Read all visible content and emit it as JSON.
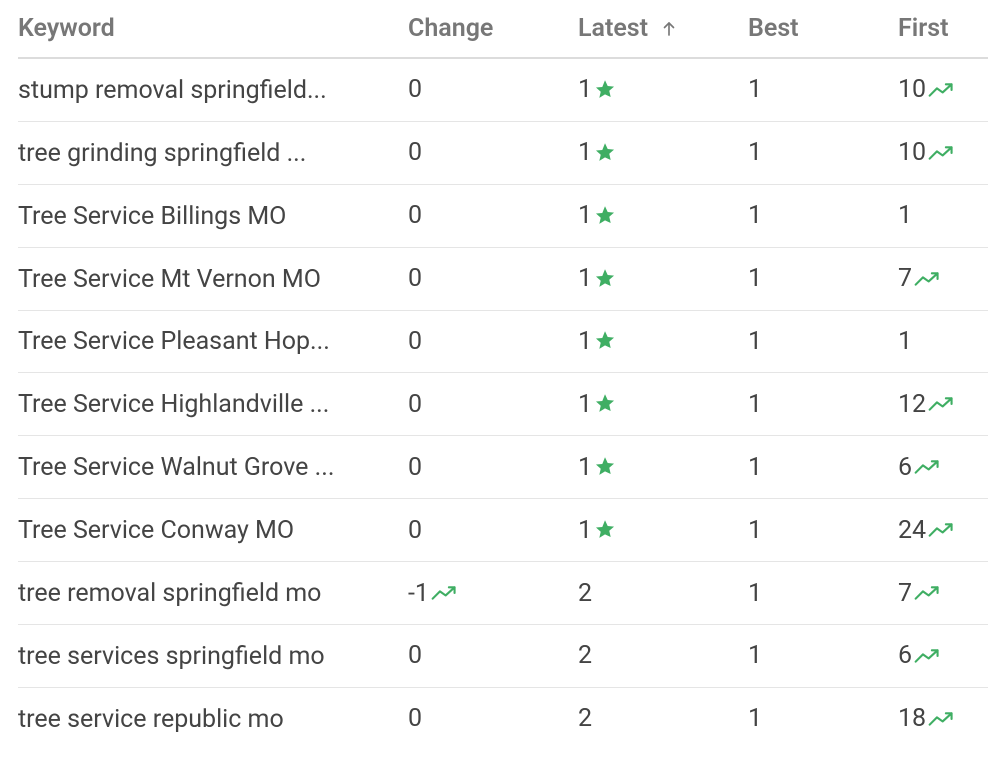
{
  "colors": {
    "green": "#3fae63",
    "headerText": "#777",
    "bodyText": "#444",
    "border": "#e5e5e5"
  },
  "table": {
    "headers": {
      "keyword": "Keyword",
      "change": "Change",
      "latest": "Latest",
      "best": "Best",
      "first": "First"
    },
    "sort": {
      "column": "latest",
      "dir": "asc"
    },
    "rows": [
      {
        "keyword": "stump removal springfield...",
        "change": "0",
        "change_trend": false,
        "latest": "1",
        "latest_star": true,
        "best": "1",
        "first": "10",
        "first_trend": true
      },
      {
        "keyword": "tree grinding springfield ...",
        "change": "0",
        "change_trend": false,
        "latest": "1",
        "latest_star": true,
        "best": "1",
        "first": "10",
        "first_trend": true
      },
      {
        "keyword": "Tree Service Billings MO",
        "change": "0",
        "change_trend": false,
        "latest": "1",
        "latest_star": true,
        "best": "1",
        "first": "1",
        "first_trend": false
      },
      {
        "keyword": "Tree Service Mt Vernon MO",
        "change": "0",
        "change_trend": false,
        "latest": "1",
        "latest_star": true,
        "best": "1",
        "first": "7",
        "first_trend": true
      },
      {
        "keyword": "Tree Service Pleasant Hop...",
        "change": "0",
        "change_trend": false,
        "latest": "1",
        "latest_star": true,
        "best": "1",
        "first": "1",
        "first_trend": false
      },
      {
        "keyword": "Tree Service Highlandville ...",
        "change": "0",
        "change_trend": false,
        "latest": "1",
        "latest_star": true,
        "best": "1",
        "first": "12",
        "first_trend": true
      },
      {
        "keyword": "Tree Service Walnut Grove ...",
        "change": "0",
        "change_trend": false,
        "latest": "1",
        "latest_star": true,
        "best": "1",
        "first": "6",
        "first_trend": true
      },
      {
        "keyword": "Tree Service Conway MO",
        "change": "0",
        "change_trend": false,
        "latest": "1",
        "latest_star": true,
        "best": "1",
        "first": "24",
        "first_trend": true
      },
      {
        "keyword": "tree removal springfield mo",
        "change": "-1",
        "change_trend": true,
        "latest": "2",
        "latest_star": false,
        "best": "1",
        "first": "7",
        "first_trend": true
      },
      {
        "keyword": "tree services springfield mo",
        "change": "0",
        "change_trend": false,
        "latest": "2",
        "latest_star": false,
        "best": "1",
        "first": "6",
        "first_trend": true
      },
      {
        "keyword": "tree service republic mo",
        "change": "0",
        "change_trend": false,
        "latest": "2",
        "latest_star": false,
        "best": "1",
        "first": "18",
        "first_trend": true
      }
    ]
  }
}
